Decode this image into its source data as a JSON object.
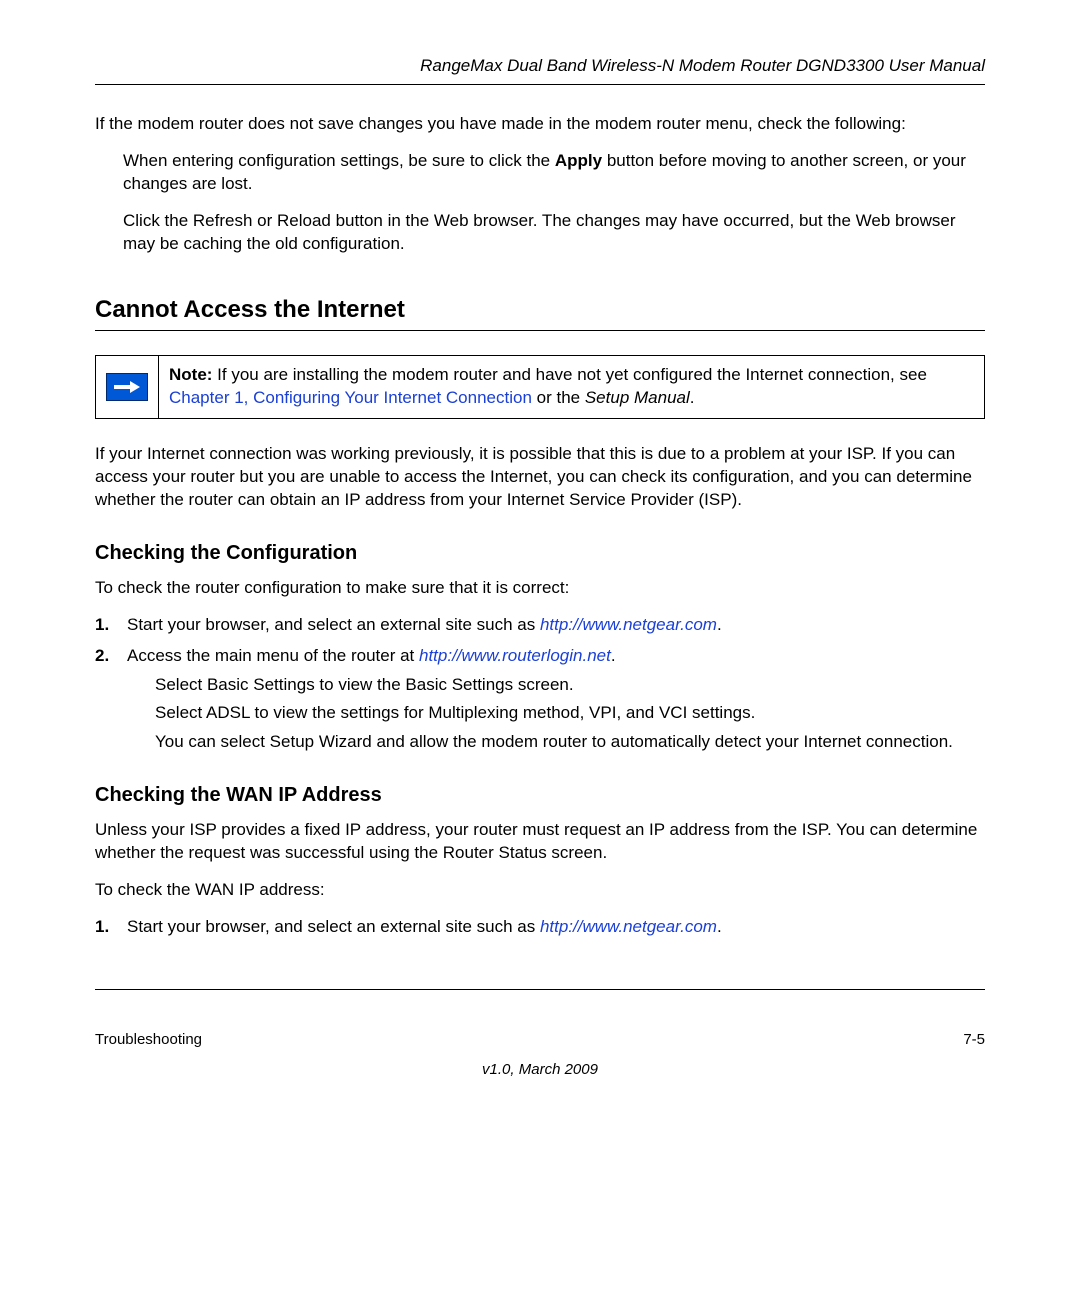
{
  "header": {
    "manual_title": "RangeMax Dual Band Wireless-N Modem Router DGND3300 User Manual"
  },
  "intro": {
    "p1_a": "If the modem router does not save changes you h",
    "p1_b": "ave made in the modem router menu, check the following:",
    "bullet1_a": "When entering configuration se",
    "bullet1_b": "ttings, be sure to click the ",
    "bullet1_apply": "Apply",
    "bullet1_c": " button before moving to another screen, or your changes are lost.",
    "bullet2_a": "Click the Refresh or Reload button in the We",
    "bullet2_b": "b browser. The changes may have occurred, but the Web browser may be caching the old configuration."
  },
  "section1": {
    "heading": "Cannot Access the Internet",
    "note_label": "Note:",
    "note_a": " If you are installing the modem router a",
    "note_b": "nd have not yet configured the Internet connection, see ",
    "note_link": "Chapter 1,  Configuring Your Internet Connection",
    "note_c": " or the ",
    "note_setup": "Setup Manual",
    "note_d": ".",
    "p1_a": "If your Internet conn",
    "p1_b": "ection was working previously, it is possibl",
    "p1_c": "e that this is due to a problem at your ISP. If you can access your router but you ",
    "p1_d": "are unable to access the Internet, you can check its configuration, and you can determine whether ",
    "p1_e": "the router can obtain an IP address from your Internet Service Provider (ISP)."
  },
  "sub1": {
    "heading": "Checking the Configuration",
    "p1_a": "To check the router configuration ",
    "p1_b": "to make sure that it is correct: ",
    "step1_num": "1.",
    "step1_a": "Start your browser, and select an external site su",
    "step1_b": "ch as ",
    "step1_url": "http://www.netgear.com",
    "step1_c": ".",
    "step2_num": "2.",
    "step2_a": "Access the main menu of the router ",
    "step2_b": "at ",
    "step2_url": "http://www.routerlogin.net",
    "step2_c": ".",
    "step2_sub1_a": "Select Basic Settings to vi",
    "step2_sub1_b": "ew the Basic Settings screen.",
    "step2_sub2_a": "Select ADSL to view the settings for Mu",
    "step2_sub2_b": "ltiplexing method, VPI, and VCI settings.",
    "step2_sub3_a": "You can select Setup Wizard and allow the mo",
    "step2_sub3_b": "dem router to automatically detect your Internet connection."
  },
  "sub2": {
    "heading": "Checking the WAN IP Address",
    "p1_a": "Unless your ISP provides a fixed IP address, your ",
    "p1_b": "router must request an IP address from the ISP. You can determine whether the request was ",
    "p1_c": "successful using the Router Status screen.",
    "p2": "To check the WAN IP address: ",
    "step1_num": "1.",
    "step1_a": "Start your browser, and select an external site su",
    "step1_b": "ch as ",
    "step1_url": "http://www.netgear.com",
    "step1_c": "."
  },
  "footer": {
    "left": "Troubleshooting",
    "right": "7-5",
    "center": "v1.0, March 2009"
  }
}
